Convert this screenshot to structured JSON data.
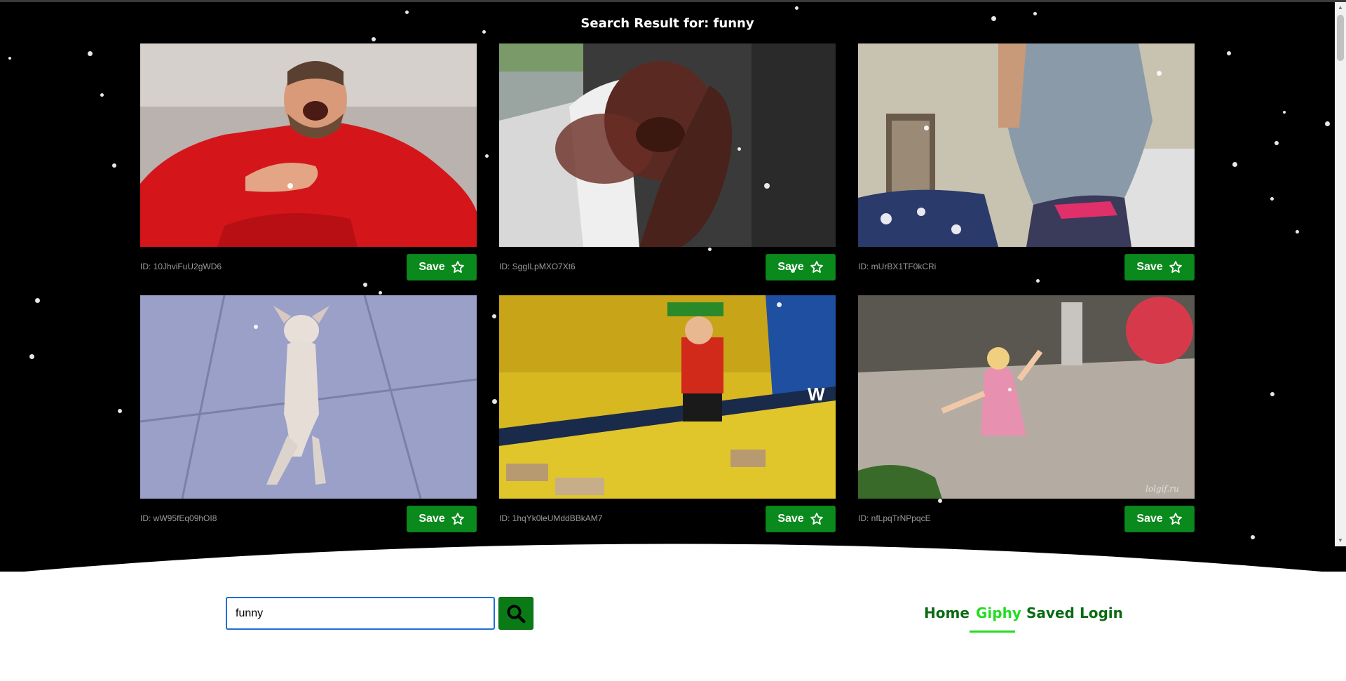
{
  "header": {
    "title": "Search Result for: funny"
  },
  "results": [
    {
      "id_text": "ID: 10JhviFuU2gWD6",
      "save_label": "Save"
    },
    {
      "id_text": "ID: SggILpMXO7Xt6",
      "save_label": "Save"
    },
    {
      "id_text": "ID: mUrBX1TF0kCRi",
      "save_label": "Save"
    },
    {
      "id_text": "ID: wW95fEq09hOI8",
      "save_label": "Save"
    },
    {
      "id_text": "ID: 1hqYk0leUMddBBkAM7",
      "save_label": "Save"
    },
    {
      "id_text": "ID: nfLpqTrNPpqcE",
      "save_label": "Save"
    }
  ],
  "search": {
    "value": "funny"
  },
  "nav": {
    "items": [
      {
        "label": "Home",
        "active": false
      },
      {
        "label": "Giphy",
        "active": true
      },
      {
        "label": "Saved",
        "active": false
      },
      {
        "label": "Login",
        "active": false
      }
    ]
  },
  "thumbnails": {
    "6": {
      "watermark": "lolgif.ru"
    },
    "5": {
      "watermark": "W"
    }
  },
  "icons": {
    "save": "star-outline-icon",
    "search": "search-icon"
  },
  "colors": {
    "save_button": "#0a8a1c",
    "nav_text": "#0a6a12",
    "nav_active": "#22dd22",
    "background": "#000000"
  }
}
